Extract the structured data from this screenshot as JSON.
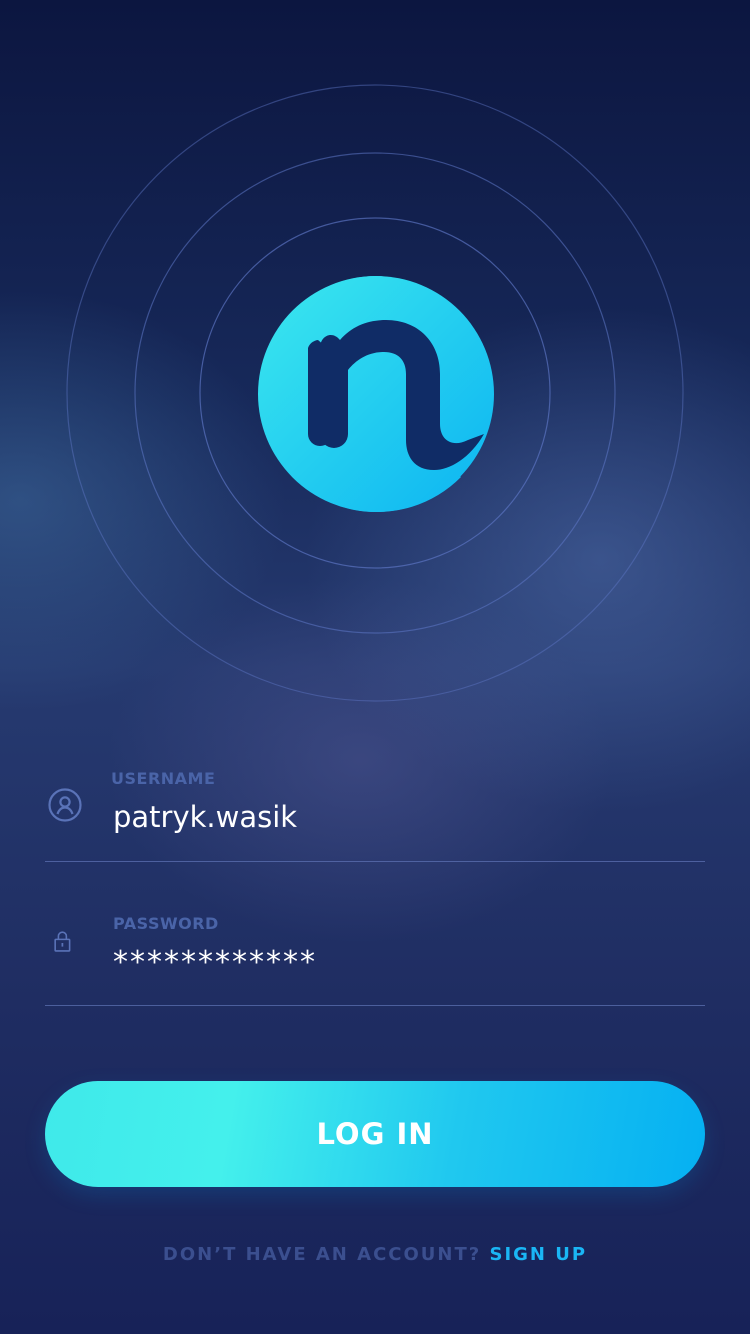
{
  "theme": {
    "accent": "#14b9f2",
    "accent_light": "#42efec",
    "label_color": "#4a64a8",
    "link_color": "#1ab6f5",
    "background_top": "#0c1640",
    "background_bottom": "#172258"
  },
  "logo": {
    "icon": "n-logo-icon"
  },
  "form": {
    "username": {
      "label": "USERNAME",
      "value": "patryk.wasik",
      "icon": "user-icon"
    },
    "password": {
      "label": "PASSWORD",
      "value": "************",
      "icon": "lock-icon"
    }
  },
  "login_button": {
    "label": "LOG IN"
  },
  "signup": {
    "prompt": "DON’T HAVE AN ACCOUNT?",
    "link": "SIGN UP"
  }
}
